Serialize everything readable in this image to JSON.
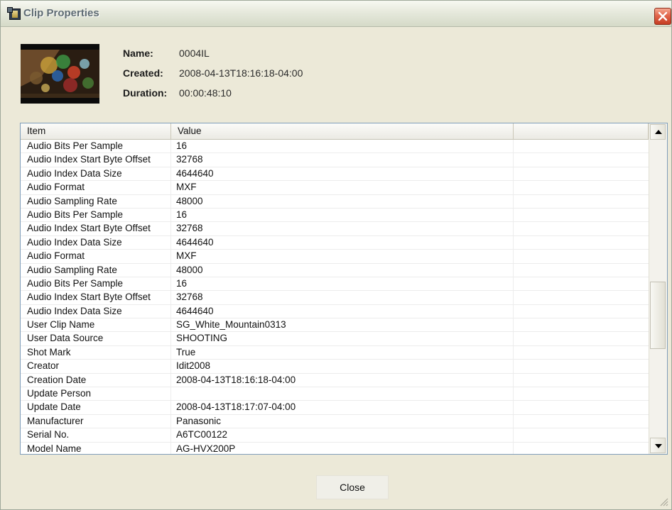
{
  "window": {
    "title": "Clip Properties"
  },
  "clip": {
    "name_label": "Name:",
    "name_value": "0004IL",
    "created_label": "Created:",
    "created_value": "2008-04-13T18:16:18-04:00",
    "duration_label": "Duration:",
    "duration_value": "00:00:48:10"
  },
  "table": {
    "columns": [
      "Item",
      "Value",
      ""
    ],
    "rows": [
      [
        "Audio Bits Per Sample",
        "16"
      ],
      [
        "Audio Index Start Byte Offset",
        "32768"
      ],
      [
        "Audio Index Data Size",
        "4644640"
      ],
      [
        "Audio Format",
        "MXF"
      ],
      [
        "Audio Sampling Rate",
        "48000"
      ],
      [
        "Audio Bits Per Sample",
        "16"
      ],
      [
        "Audio Index Start Byte Offset",
        "32768"
      ],
      [
        "Audio Index Data Size",
        "4644640"
      ],
      [
        "Audio Format",
        "MXF"
      ],
      [
        "Audio Sampling Rate",
        "48000"
      ],
      [
        "Audio Bits Per Sample",
        "16"
      ],
      [
        "Audio Index Start Byte Offset",
        "32768"
      ],
      [
        "Audio Index Data Size",
        "4644640"
      ],
      [
        "User Clip Name",
        "SG_White_Mountain0313"
      ],
      [
        "User Data Source",
        "SHOOTING"
      ],
      [
        "Shot Mark",
        "True"
      ],
      [
        "Creator",
        "Idit2008"
      ],
      [
        "Creation Date",
        "2008-04-13T18:16:18-04:00"
      ],
      [
        "Update Person",
        ""
      ],
      [
        "Update Date",
        "2008-04-13T18:17:07-04:00"
      ],
      [
        "Manufacturer",
        "Panasonic"
      ],
      [
        "Serial No.",
        "A6TC00122"
      ],
      [
        "Model Name",
        "AG-HVX200P"
      ]
    ]
  },
  "buttons": {
    "close": "Close"
  },
  "icons": {
    "app": "clip-properties-icon",
    "close": "close-icon",
    "scroll_up": "scroll-up-arrow-icon",
    "scroll_down": "scroll-down-arrow-icon",
    "resize": "resize-grip-icon"
  },
  "colors": {
    "window_bg": "#ece9d8",
    "close_red": "#d9522f",
    "list_border": "#7f9db9"
  }
}
